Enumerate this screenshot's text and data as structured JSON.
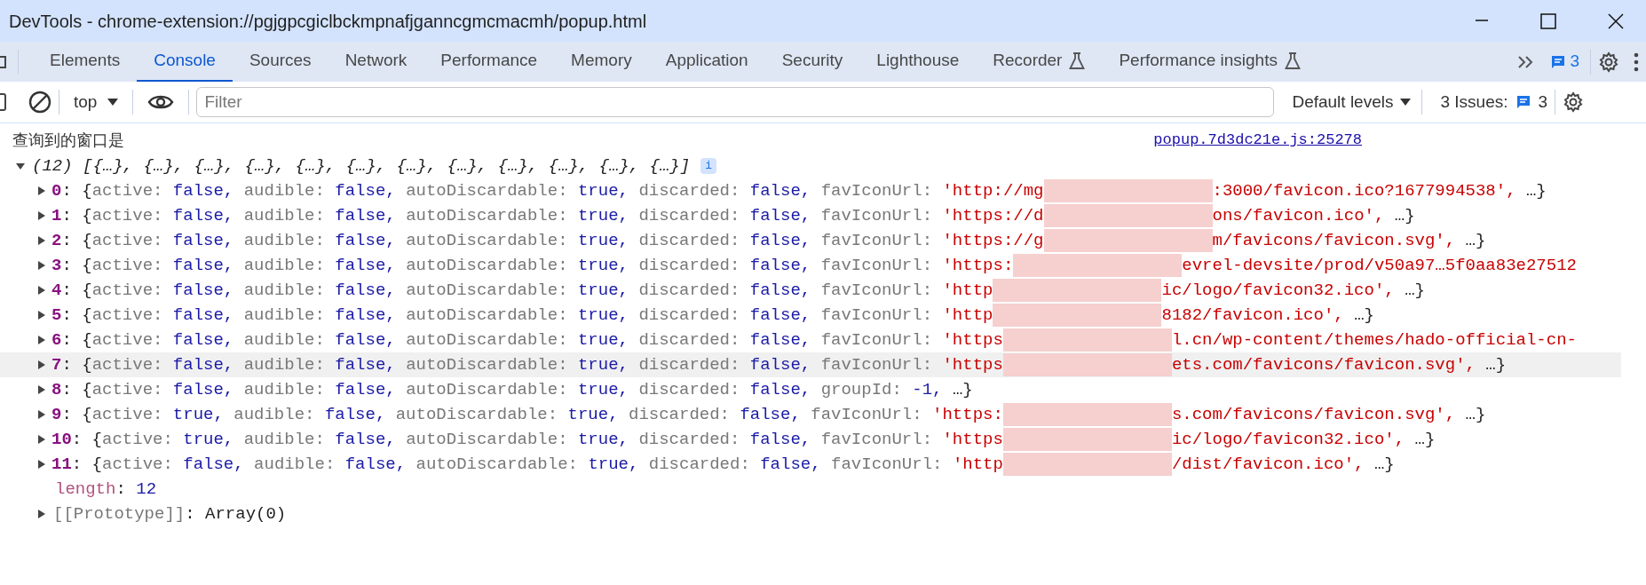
{
  "window": {
    "title": "DevTools - chrome-extension://pgjgpcgiclbckmpnafjganncgmcmacmh/popup.html"
  },
  "tabs": [
    {
      "label": "Elements",
      "selected": false,
      "experimental": false
    },
    {
      "label": "Console",
      "selected": true,
      "experimental": false
    },
    {
      "label": "Sources",
      "selected": false,
      "experimental": false
    },
    {
      "label": "Network",
      "selected": false,
      "experimental": false
    },
    {
      "label": "Performance",
      "selected": false,
      "experimental": false
    },
    {
      "label": "Memory",
      "selected": false,
      "experimental": false
    },
    {
      "label": "Application",
      "selected": false,
      "experimental": false
    },
    {
      "label": "Security",
      "selected": false,
      "experimental": false
    },
    {
      "label": "Lighthouse",
      "selected": false,
      "experimental": false
    },
    {
      "label": "Recorder",
      "selected": false,
      "experimental": true
    },
    {
      "label": "Performance insights",
      "selected": false,
      "experimental": true
    }
  ],
  "tab_issues_count": "3",
  "toolbar": {
    "context": "top",
    "filter_placeholder": "Filter",
    "levels": "Default levels",
    "issues_label": "3 Issues:",
    "issues_count": "3"
  },
  "console": {
    "message": "查询到的窗口是",
    "source": "popup.7d3dc21e.js:25278",
    "array": {
      "expanded": true,
      "summary": "(12) [{…}, {…}, {…}, {…}, {…}, {…}, {…}, {…}, {…}, {…}, {…}, {…}]",
      "info": "i"
    },
    "entries": [
      {
        "index": "0",
        "sep": ": {",
        "hovered": false,
        "expanded": false,
        "props": [
          {
            "key": "active: ",
            "value": "false, ",
            "kind": "literal"
          },
          {
            "key": "audible: ",
            "value": "false, ",
            "kind": "literal"
          },
          {
            "key": "autoDiscardable: ",
            "value": "true, ",
            "kind": "literal"
          },
          {
            "key": "discarded: ",
            "value": "false, ",
            "kind": "literal"
          },
          {
            "key": "favIconUrl: ",
            "value": "'http://mg",
            "redacted": true,
            "value_end": ":3000/favicon.ico?1677994538', ",
            "kind": "string"
          }
        ],
        "tail": "…}"
      },
      {
        "index": "1",
        "sep": ": {",
        "hovered": false,
        "expanded": false,
        "props": [
          {
            "key": "active: ",
            "value": "false, ",
            "kind": "literal"
          },
          {
            "key": "audible: ",
            "value": "false, ",
            "kind": "literal"
          },
          {
            "key": "autoDiscardable: ",
            "value": "true, ",
            "kind": "literal"
          },
          {
            "key": "discarded: ",
            "value": "false, ",
            "kind": "literal"
          },
          {
            "key": "favIconUrl: ",
            "value": "'https://d",
            "redacted": true,
            "value_end": "ons/favicon.ico', ",
            "kind": "string"
          }
        ],
        "tail": "…}"
      },
      {
        "index": "2",
        "sep": ": {",
        "hovered": false,
        "expanded": false,
        "props": [
          {
            "key": "active: ",
            "value": "false, ",
            "kind": "literal"
          },
          {
            "key": "audible: ",
            "value": "false, ",
            "kind": "literal"
          },
          {
            "key": "autoDiscardable: ",
            "value": "true, ",
            "kind": "literal"
          },
          {
            "key": "discarded: ",
            "value": "false, ",
            "kind": "literal"
          },
          {
            "key": "favIconUrl: ",
            "value": "'https://g",
            "redacted": true,
            "value_end": "m/favicons/favicon.svg', ",
            "kind": "string"
          }
        ],
        "tail": "…}"
      },
      {
        "index": "3",
        "sep": ": {",
        "hovered": false,
        "expanded": false,
        "props": [
          {
            "key": "active: ",
            "value": "false, ",
            "kind": "literal"
          },
          {
            "key": "audible: ",
            "value": "false, ",
            "kind": "literal"
          },
          {
            "key": "autoDiscardable: ",
            "value": "true, ",
            "kind": "literal"
          },
          {
            "key": "discarded: ",
            "value": "false, ",
            "kind": "literal"
          },
          {
            "key": "favIconUrl: ",
            "value": "'https:",
            "redacted": true,
            "value_end": "evrel-devsite/prod/v50a97…5f0aa83e27512",
            "kind": "string"
          }
        ]
      },
      {
        "index": "4",
        "sep": ": {",
        "hovered": false,
        "expanded": false,
        "props": [
          {
            "key": "active: ",
            "value": "false, ",
            "kind": "literal"
          },
          {
            "key": "audible: ",
            "value": "false, ",
            "kind": "literal"
          },
          {
            "key": "autoDiscardable: ",
            "value": "true, ",
            "kind": "literal"
          },
          {
            "key": "discarded: ",
            "value": "false, ",
            "kind": "literal"
          },
          {
            "key": "favIconUrl: ",
            "value": "'http",
            "redacted": true,
            "value_end": "ic/logo/favicon32.ico', ",
            "kind": "string"
          }
        ],
        "tail": "…}"
      },
      {
        "index": "5",
        "sep": ": {",
        "hovered": false,
        "expanded": false,
        "props": [
          {
            "key": "active: ",
            "value": "false, ",
            "kind": "literal"
          },
          {
            "key": "audible: ",
            "value": "false, ",
            "kind": "literal"
          },
          {
            "key": "autoDiscardable: ",
            "value": "true, ",
            "kind": "literal"
          },
          {
            "key": "discarded: ",
            "value": "false, ",
            "kind": "literal"
          },
          {
            "key": "favIconUrl: ",
            "value": "'http",
            "redacted": true,
            "value_end": "8182/favicon.ico', ",
            "kind": "string"
          }
        ],
        "tail": "…}"
      },
      {
        "index": "6",
        "sep": ": {",
        "hovered": false,
        "expanded": false,
        "props": [
          {
            "key": "active: ",
            "value": "false, ",
            "kind": "literal"
          },
          {
            "key": "audible: ",
            "value": "false, ",
            "kind": "literal"
          },
          {
            "key": "autoDiscardable: ",
            "value": "true, ",
            "kind": "literal"
          },
          {
            "key": "discarded: ",
            "value": "false, ",
            "kind": "literal"
          },
          {
            "key": "favIconUrl: ",
            "value": "'https",
            "redacted": true,
            "value_end": "l.cn/wp-content/themes/hado-official-cn-",
            "kind": "string"
          }
        ]
      },
      {
        "index": "7",
        "sep": ": {",
        "hovered": true,
        "expanded": false,
        "props": [
          {
            "key": "active: ",
            "value": "false, ",
            "kind": "literal"
          },
          {
            "key": "audible: ",
            "value": "false, ",
            "kind": "literal"
          },
          {
            "key": "autoDiscardable: ",
            "value": "true, ",
            "kind": "literal"
          },
          {
            "key": "discarded: ",
            "value": "false, ",
            "kind": "literal"
          },
          {
            "key": "favIconUrl: ",
            "value": "'https",
            "redacted": true,
            "value_end": "ets.com/favicons/favicon.svg', ",
            "kind": "string"
          }
        ],
        "tail": "…}"
      },
      {
        "index": "8",
        "sep": ": {",
        "hovered": false,
        "expanded": false,
        "props": [
          {
            "key": "active: ",
            "value": "false, ",
            "kind": "literal"
          },
          {
            "key": "audible: ",
            "value": "false, ",
            "kind": "literal"
          },
          {
            "key": "autoDiscardable: ",
            "value": "true, ",
            "kind": "literal"
          },
          {
            "key": "discarded: ",
            "value": "false, ",
            "kind": "literal"
          },
          {
            "key": "groupId: ",
            "value": "-1, ",
            "kind": "literal"
          }
        ],
        "tail": "…}"
      },
      {
        "index": "9",
        "sep": ": {",
        "hovered": false,
        "expanded": false,
        "props": [
          {
            "key": "active: ",
            "value": "true, ",
            "kind": "literal"
          },
          {
            "key": "audible: ",
            "value": "false, ",
            "kind": "literal"
          },
          {
            "key": "autoDiscardable: ",
            "value": "true, ",
            "kind": "literal"
          },
          {
            "key": "discarded: ",
            "value": "false, ",
            "kind": "literal"
          },
          {
            "key": "favIconUrl: ",
            "value": "'https:",
            "redacted": true,
            "value_end": "s.com/favicons/favicon.svg', ",
            "kind": "string"
          }
        ],
        "tail": "…}"
      },
      {
        "index": "10",
        "sep": ": {",
        "hovered": false,
        "expanded": false,
        "props": [
          {
            "key": "active: ",
            "value": "true, ",
            "kind": "literal"
          },
          {
            "key": "audible: ",
            "value": "false, ",
            "kind": "literal"
          },
          {
            "key": "autoDiscardable: ",
            "value": "true, ",
            "kind": "literal"
          },
          {
            "key": "discarded: ",
            "value": "false, ",
            "kind": "literal"
          },
          {
            "key": "favIconUrl: ",
            "value": "'https",
            "redacted": true,
            "value_end": "ic/logo/favicon32.ico', ",
            "kind": "string"
          }
        ],
        "tail": "…}"
      },
      {
        "index": "11",
        "sep": ": {",
        "hovered": false,
        "expanded": false,
        "props": [
          {
            "key": "active: ",
            "value": "false, ",
            "kind": "literal"
          },
          {
            "key": "audible: ",
            "value": "false, ",
            "kind": "literal"
          },
          {
            "key": "autoDiscardable: ",
            "value": "true, ",
            "kind": "literal"
          },
          {
            "key": "discarded: ",
            "value": "false, ",
            "kind": "literal"
          },
          {
            "key": "favIconUrl: ",
            "value": "'http",
            "redacted": true,
            "value_end": "/dist/favicon.ico', ",
            "kind": "string"
          }
        ],
        "tail": "…}"
      }
    ],
    "length": {
      "key": "length",
      "sep": ": ",
      "value": "12"
    },
    "prototype": {
      "key": "[[Prototype]]",
      "sep": ": ",
      "value": "Array(0)",
      "expanded": false
    }
  }
}
